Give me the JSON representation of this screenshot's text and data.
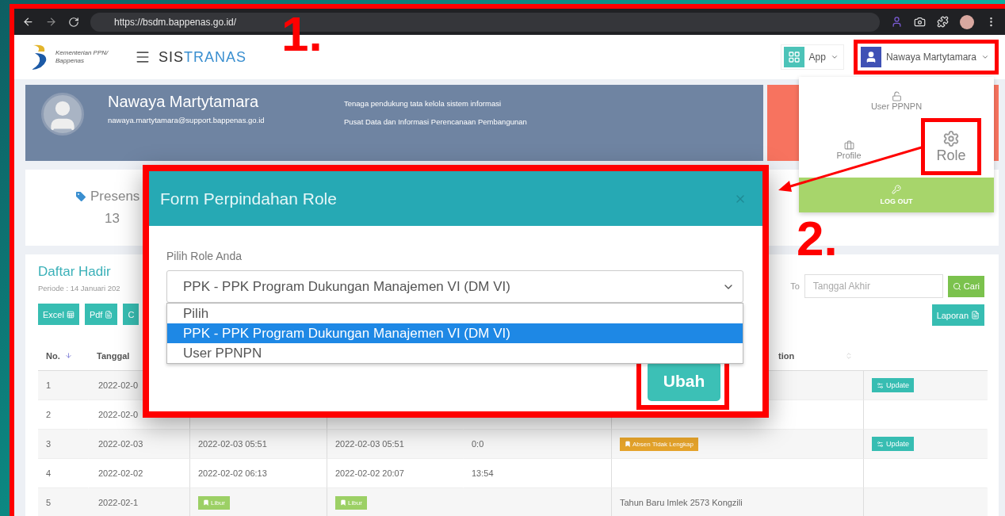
{
  "browser": {
    "url": "https://bsdm.bappenas.go.id/"
  },
  "header": {
    "org": [
      "Kementerian PPN/",
      "Bappenas"
    ],
    "brand": [
      "SIS",
      "TRANAS"
    ],
    "app_button": "App",
    "user_button": "Nawaya Martytamara"
  },
  "profile": {
    "name": "Nawaya Martytamara",
    "email": "nawaya.martytamara@support.bappenas.go.id",
    "lines": [
      "Tenaga pendukung tata kelola sistem informasi",
      "Pusat Data dan Informasi Perencanaan Pembangunan"
    ]
  },
  "stats": {
    "label": "Presens",
    "value": "13"
  },
  "attendance": {
    "title": "Daftar Hadir",
    "period": "Periode : 14 Januari 202",
    "export_buttons": [
      "Excel",
      "Pdf",
      "C"
    ],
    "to_label": "To",
    "end_date": {
      "placeholder": "Tanggal Akhir"
    },
    "search_button": "Cari",
    "report_button": "Laporan",
    "columns": [
      "No.",
      "Tanggal",
      "tion"
    ],
    "rows": [
      {
        "no": "1",
        "date": "2022-02-0",
        "action": "Update"
      },
      {
        "no": "2",
        "date": "2022-02-0"
      },
      {
        "no": "3",
        "date": "2022-02-03",
        "in": {
          "kind": "text",
          "text": "2022-02-03 05:51"
        },
        "out": {
          "kind": "text",
          "text": "2022-02-03 05:51"
        },
        "duration": "0:0",
        "note": {
          "kind": "badge",
          "text": "Absen Tidak Lengkap",
          "color": "#e6a42b"
        },
        "action": "Update"
      },
      {
        "no": "4",
        "date": "2022-02-02",
        "in": {
          "kind": "text",
          "text": "2022-02-02 06:13"
        },
        "out": {
          "kind": "text",
          "text": "2022-02-02 20:07"
        },
        "duration": "13:54"
      },
      {
        "no": "5",
        "date": "2022-02-1",
        "in": {
          "kind": "badge",
          "text": "Libur",
          "color": "#9cd065"
        },
        "out": {
          "kind": "badge",
          "text": "Libur",
          "color": "#9cd065"
        },
        "note": {
          "kind": "text",
          "text": "Tahun Baru Imlek 2573 Kongzili"
        }
      }
    ]
  },
  "modal": {
    "title": "Form Perpindahan Role",
    "label": "Pilih Role Anda",
    "select": {
      "value": "PPK - PPK Program Dukungan Manajemen VI (DM VI)",
      "options": [
        {
          "label": "Pilih",
          "selected": false
        },
        {
          "label": "PPK - PPK Program Dukungan Manajemen VI (DM VI)",
          "selected": true
        },
        {
          "label": "User PPNPN",
          "selected": false
        }
      ]
    },
    "submit": "Ubah"
  },
  "user_menu": {
    "items": [
      {
        "kind": "lock",
        "label": "User PPNPN",
        "highlighted": false
      },
      {
        "kind": "profile",
        "label": "Profile",
        "highlighted": false
      },
      {
        "kind": "role",
        "label": "Role",
        "highlighted": true
      }
    ],
    "logout": "LOG OUT"
  },
  "markers": [
    "1.",
    "2."
  ]
}
